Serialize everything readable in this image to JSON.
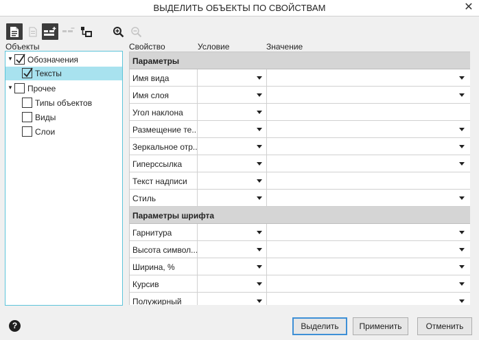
{
  "window": {
    "title": "ВЫДЕЛИТЬ ОБЪЕКТЫ ПО СВОЙСТВАМ",
    "close_glyph": "✕"
  },
  "toolbar": {
    "buttons": [
      {
        "icon": "new-document-icon",
        "state": "pressed"
      },
      {
        "icon": "document-icon",
        "state": "disabled"
      },
      {
        "icon": "add-condition-icon",
        "state": "enabled"
      },
      {
        "icon": "remove-condition-icon",
        "state": "disabled"
      },
      {
        "icon": "select-objects-icon",
        "state": "enabled"
      },
      {
        "icon": "zoom-in-icon",
        "state": "enabled"
      },
      {
        "icon": "zoom-out-icon",
        "state": "disabled"
      }
    ]
  },
  "labels": {
    "objects": "Объекты",
    "property": "Свойство",
    "condition": "Условие",
    "value": "Значение"
  },
  "tree": {
    "items": [
      {
        "label": "Обозначения",
        "level": 0,
        "expanded": true,
        "checked": true,
        "selected": false
      },
      {
        "label": "Тексты",
        "level": 1,
        "checked": true,
        "selected": true
      },
      {
        "label": "Прочее",
        "level": 0,
        "expanded": true,
        "checked": false,
        "selected": false
      },
      {
        "label": "Типы объектов",
        "level": 1,
        "checked": false,
        "selected": false
      },
      {
        "label": "Виды",
        "level": 1,
        "checked": false,
        "selected": false
      },
      {
        "label": "Слои",
        "level": 1,
        "checked": false,
        "selected": false
      }
    ]
  },
  "grid": {
    "rows": [
      {
        "type": "group",
        "label": "Параметры"
      },
      {
        "type": "prop",
        "label": "Имя вида",
        "value_dropdown": true
      },
      {
        "type": "prop",
        "label": "Имя слоя",
        "value_dropdown": true
      },
      {
        "type": "prop",
        "label": "Угол наклона",
        "value_dropdown": false
      },
      {
        "type": "prop",
        "label": "Размещение те...",
        "value_dropdown": true
      },
      {
        "type": "prop",
        "label": "Зеркальное отр...",
        "value_dropdown": true
      },
      {
        "type": "prop",
        "label": "Гиперссылка",
        "value_dropdown": true
      },
      {
        "type": "prop",
        "label": "Текст надписи",
        "value_dropdown": false
      },
      {
        "type": "prop",
        "label": "Стиль",
        "value_dropdown": true
      },
      {
        "type": "group",
        "label": "Параметры шрифта"
      },
      {
        "type": "prop",
        "label": "Гарнитура",
        "value_dropdown": true
      },
      {
        "type": "prop",
        "label": "Высота символ...",
        "value_dropdown": true
      },
      {
        "type": "prop",
        "label": "Ширина, %",
        "value_dropdown": true
      },
      {
        "type": "prop",
        "label": "Курсив",
        "value_dropdown": true
      },
      {
        "type": "prop",
        "label": "Полужирный",
        "value_dropdown": true
      }
    ]
  },
  "footer": {
    "help_glyph": "?",
    "select_label": "Выделить",
    "apply_label": "Применить",
    "cancel_label": "Отменить"
  },
  "colors": {
    "accent_border": "#5bc4d9",
    "selection": "#a8e2ef",
    "group_header": "#d5d5d5",
    "primary_button_border": "#3d8fd6"
  }
}
